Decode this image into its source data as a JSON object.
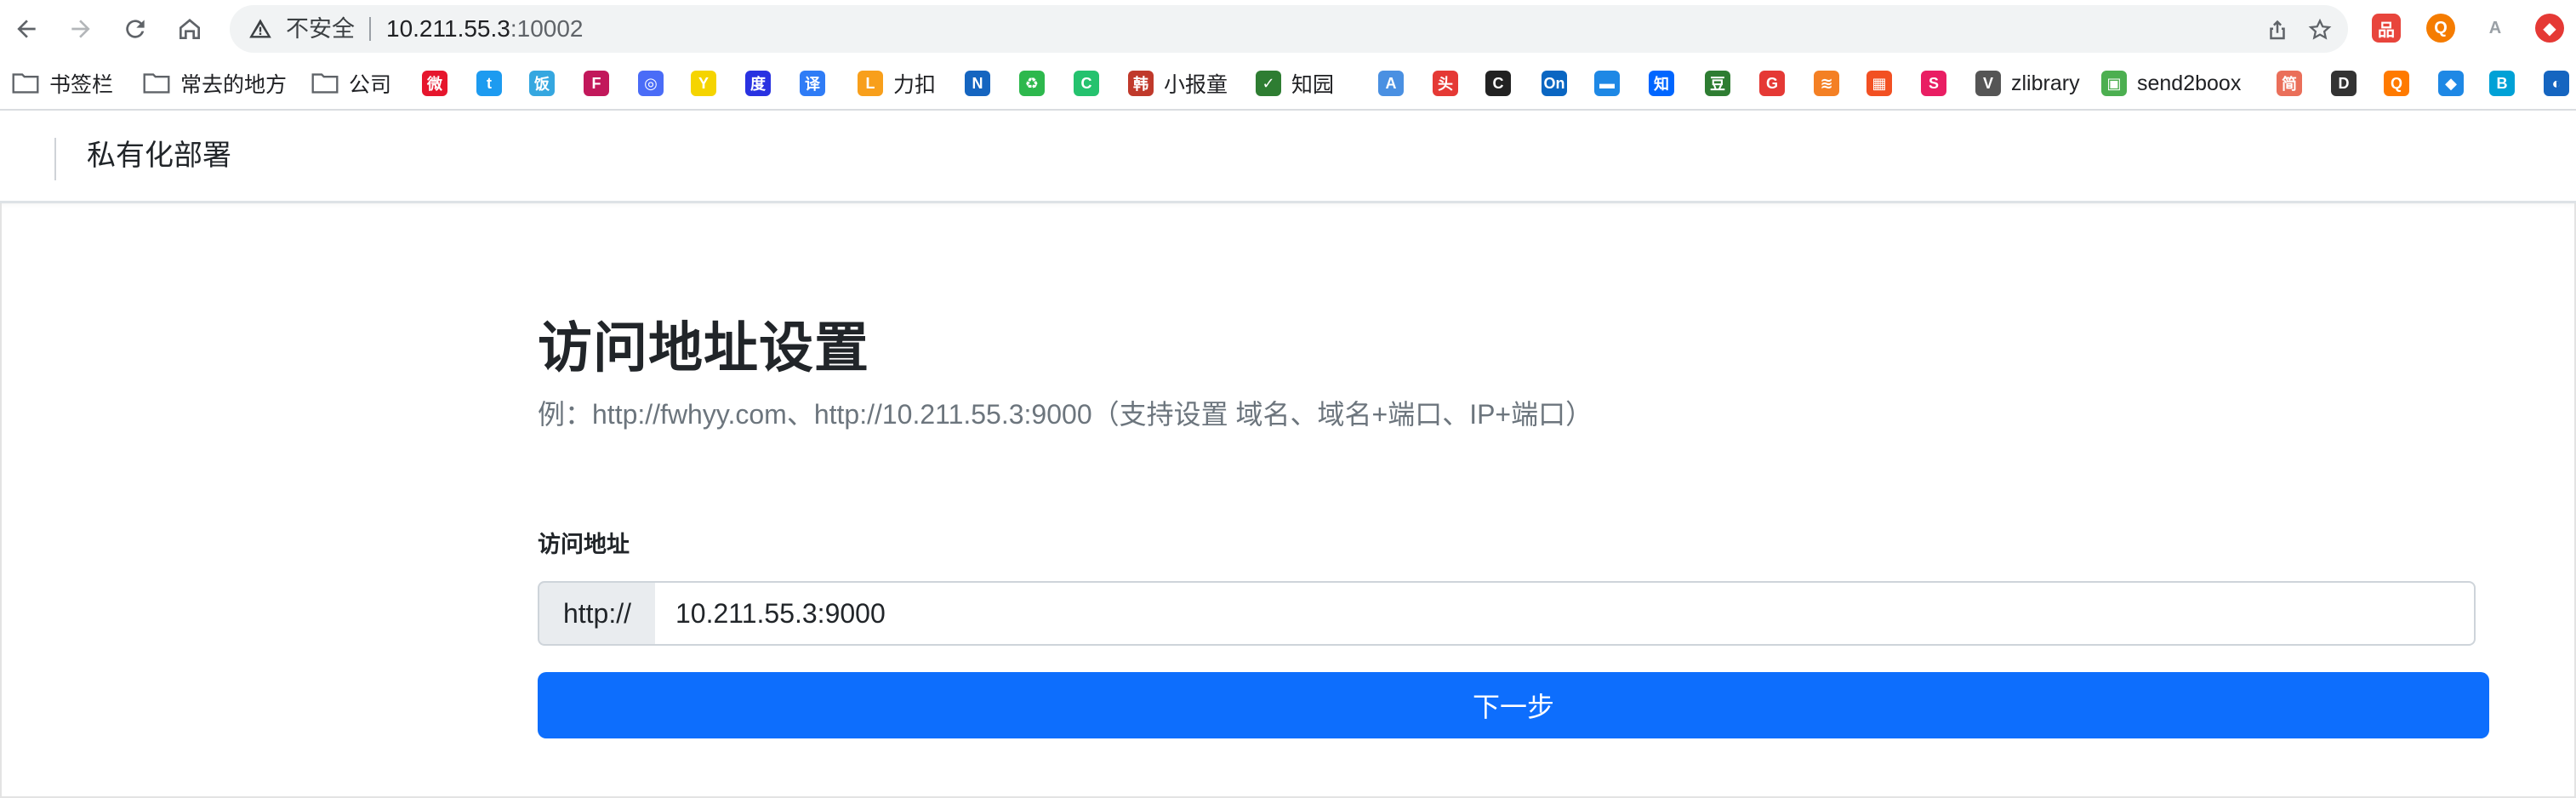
{
  "browser": {
    "security_label": "不安全",
    "url_host": "10.211.55.3",
    "url_port": ":10002",
    "icons": [
      "back-icon",
      "forward-icon",
      "reload-icon",
      "home-icon",
      "warning-icon",
      "share-icon",
      "bookmark-star-icon"
    ]
  },
  "extensions": [
    {
      "name": "ext-red-icon",
      "glyph": "品",
      "color": "#e8453c"
    },
    {
      "name": "ext-orange-icon",
      "glyph": "Q",
      "color": "#f57c00"
    },
    {
      "name": "ext-gray-icon",
      "glyph": "A",
      "color": "#9aa0a6"
    },
    {
      "name": "ext-red-circle-icon",
      "glyph": "◆",
      "color": "#e53935"
    }
  ],
  "bookmarks": [
    {
      "label": "书签栏",
      "type": "folder"
    },
    {
      "label": "常去的地方",
      "type": "folder"
    },
    {
      "label": "公司",
      "type": "folder"
    },
    {
      "label": "",
      "glyph": "微",
      "color": "#e6162d"
    },
    {
      "label": "",
      "glyph": "t",
      "color": "#1d9bf0"
    },
    {
      "label": "",
      "glyph": "饭",
      "color": "#35a7e0"
    },
    {
      "label": "",
      "glyph": "F",
      "color": "#c2185b"
    },
    {
      "label": "",
      "glyph": "◎",
      "color": "#4a6cf7"
    },
    {
      "label": "",
      "glyph": "Y",
      "color": "#f5d400"
    },
    {
      "label": "",
      "glyph": "度",
      "color": "#2932e1"
    },
    {
      "label": "",
      "glyph": "译",
      "color": "#2f7cf6"
    },
    {
      "label": "力扣",
      "glyph": "L",
      "color": "#f89f1b"
    },
    {
      "label": "",
      "glyph": "N",
      "color": "#1565c0"
    },
    {
      "label": "",
      "glyph": "♻",
      "color": "#2db84d"
    },
    {
      "label": "",
      "glyph": "C",
      "color": "#25c26e"
    },
    {
      "label": "小报童",
      "glyph": "韩",
      "color": "#c0392b"
    },
    {
      "label": "知园",
      "glyph": "✓",
      "color": "#2e7d32"
    },
    {
      "label": "",
      "glyph": "A",
      "color": "#4a90e2"
    },
    {
      "label": "",
      "glyph": "头",
      "color": "#e53935"
    },
    {
      "label": "",
      "glyph": "C",
      "color": "#222222"
    },
    {
      "label": "",
      "glyph": "On",
      "color": "#0a66c2"
    },
    {
      "label": "",
      "glyph": "▬",
      "color": "#1e88e5"
    },
    {
      "label": "",
      "glyph": "知",
      "color": "#0066ff"
    },
    {
      "label": "",
      "glyph": "豆",
      "color": "#2e7d32"
    },
    {
      "label": "",
      "glyph": "G",
      "color": "#e53935"
    },
    {
      "label": "",
      "glyph": "≋",
      "color": "#f48024"
    },
    {
      "label": "",
      "glyph": "▦",
      "color": "#f25022"
    },
    {
      "label": "",
      "glyph": "S",
      "color": "#e91e63"
    },
    {
      "label": "zlibrary",
      "glyph": "V",
      "color": "#555555"
    },
    {
      "label": "send2boox",
      "glyph": "▣",
      "color": "#4caf50"
    },
    {
      "label": "",
      "glyph": "简",
      "color": "#ea6f5a"
    },
    {
      "label": "",
      "glyph": "D",
      "color": "#333333"
    },
    {
      "label": "",
      "glyph": "Q",
      "color": "#ff7a00"
    },
    {
      "label": "",
      "glyph": "◆",
      "color": "#1e88e5"
    },
    {
      "label": "",
      "glyph": "B",
      "color": "#00a1d6"
    },
    {
      "label": "",
      "glyph": "◐",
      "color": "#1565c0"
    }
  ],
  "header": {
    "brand": "私有化部署"
  },
  "main": {
    "title": "访问地址设置",
    "subtitle": "例：http://fwhyy.com、http://10.211.55.3:9000（支持设置 域名、域名+端口、IP+端口）",
    "field_label": "访问地址",
    "prefix": "http://",
    "input_value": "10.211.55.3:9000",
    "button_label": "下一步"
  },
  "colors": {
    "primary": "#0d6efd",
    "muted_text": "#6c757d",
    "addon_bg": "#e9ecef"
  }
}
